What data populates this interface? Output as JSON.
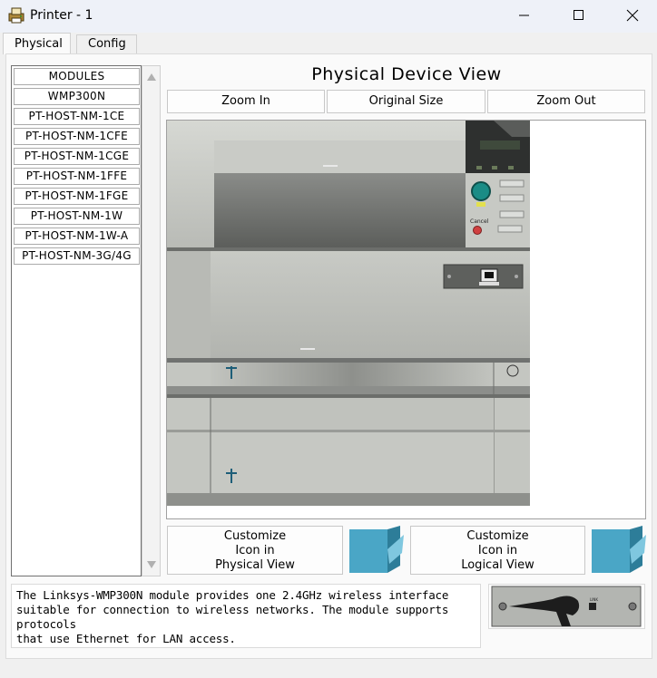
{
  "window": {
    "title": "Printer - 1",
    "icon": "printer-app-icon"
  },
  "tabs": [
    {
      "label": "Physical",
      "active": true
    },
    {
      "label": "Config",
      "active": false
    }
  ],
  "modules": [
    "MODULES",
    "WMP300N",
    "PT-HOST-NM-1CE",
    "PT-HOST-NM-1CFE",
    "PT-HOST-NM-1CGE",
    "PT-HOST-NM-1FFE",
    "PT-HOST-NM-1FGE",
    "PT-HOST-NM-1W",
    "PT-HOST-NM-1W-A",
    "PT-HOST-NM-3G/4G"
  ],
  "main": {
    "heading": "Physical Device View",
    "zoom_in": "Zoom In",
    "original_size": "Original Size",
    "zoom_out": "Zoom Out",
    "printer_cancel_label": "Cancel",
    "customize_physical": [
      "Customize",
      "Icon in",
      "Physical View"
    ],
    "customize_logical": [
      "Customize",
      "Icon in",
      "Logical View"
    ]
  },
  "description": {
    "lines": [
      "The Linksys-WMP300N module provides one 2.4GHz wireless interface",
      "suitable for connection to wireless networks. The module supports protocols",
      "that use Ethernet for LAN access."
    ]
  },
  "colors": {
    "accent_cube": "#4aa6c6",
    "printer_body": "#c5c7c2",
    "control_panel": "#2e302f",
    "teal_button": "#1a8c86"
  }
}
